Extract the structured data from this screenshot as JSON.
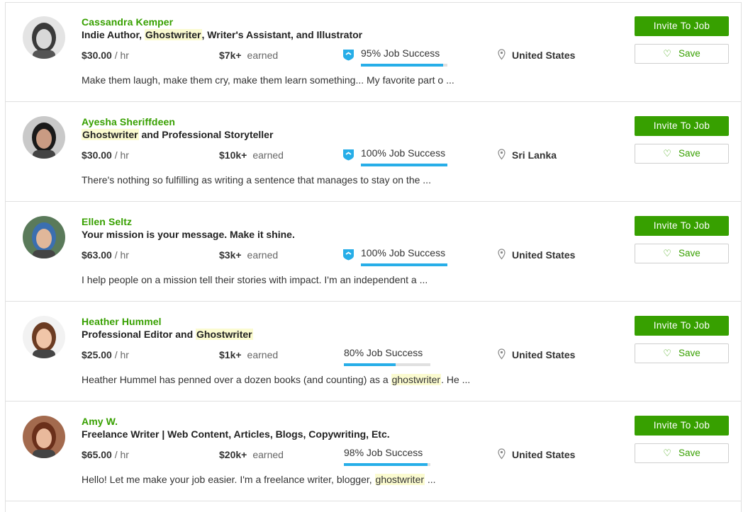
{
  "freelancers": [
    {
      "name": "Cassandra Kemper",
      "title_parts": [
        "Indie Author, ",
        "Ghostwriter",
        ", Writer's Assistant, and Illustrator"
      ],
      "rate": "$30.00",
      "rate_unit": "/ hr",
      "earned": "$7k+",
      "earned_label": "earned",
      "job_success": "95% Job Success",
      "job_success_pct": 95,
      "top_rated": true,
      "location": "United States",
      "desc_parts": [
        "Make them laugh, make them cry, make them learn something... My favorite part o ...",
        "",
        ""
      ],
      "invite_label": "Invite To Job",
      "save_label": "Save"
    },
    {
      "name": "Ayesha Sheriffdeen",
      "title_parts": [
        "",
        "Ghostwriter",
        " and Professional Storyteller"
      ],
      "rate": "$30.00",
      "rate_unit": "/ hr",
      "earned": "$10k+",
      "earned_label": "earned",
      "job_success": "100% Job Success",
      "job_success_pct": 100,
      "top_rated": true,
      "location": "Sri Lanka",
      "desc_parts": [
        "There's nothing so fulfilling as writing a sentence that manages to stay on the ...",
        "",
        ""
      ],
      "invite_label": "Invite To Job",
      "save_label": "Save"
    },
    {
      "name": "Ellen Seltz",
      "title_parts": [
        "Your mission is your message. Make it shine.",
        "",
        ""
      ],
      "rate": "$63.00",
      "rate_unit": "/ hr",
      "earned": "$3k+",
      "earned_label": "earned",
      "job_success": "100% Job Success",
      "job_success_pct": 100,
      "top_rated": true,
      "location": "United States",
      "desc_parts": [
        "I help people on a mission tell their stories with impact. I'm an independent a ...",
        "",
        ""
      ],
      "invite_label": "Invite To Job",
      "save_label": "Save"
    },
    {
      "name": "Heather Hummel",
      "title_parts": [
        "Professional Editor and ",
        "Ghostwriter",
        ""
      ],
      "rate": "$25.00",
      "rate_unit": "/ hr",
      "earned": "$1k+",
      "earned_label": "earned",
      "job_success": "80% Job Success",
      "job_success_pct": 60,
      "top_rated": false,
      "location": "United States",
      "desc_parts": [
        "Heather Hummel has penned over a dozen books (and counting) as a ",
        "ghostwriter",
        ". He ..."
      ],
      "invite_label": "Invite To Job",
      "save_label": "Save"
    },
    {
      "name": "Amy W.",
      "title_parts": [
        "Freelance Writer | Web Content, Articles, Blogs, Copywriting, Etc.",
        "",
        ""
      ],
      "rate": "$65.00",
      "rate_unit": "/ hr",
      "earned": "$20k+",
      "earned_label": "earned",
      "job_success": "98% Job Success",
      "job_success_pct": 97,
      "top_rated": false,
      "location": "United States",
      "desc_parts": [
        "Hello! Let me make your job easier. I'm a freelance writer, blogger, ",
        "ghostwriter",
        " ..."
      ],
      "invite_label": "Invite To Job",
      "save_label": "Save"
    }
  ],
  "colors": {
    "accent": "#37a000",
    "progress": "#27aee8",
    "badge": "#27aee8",
    "highlight": "#fbfbd0"
  },
  "icons": {
    "top_rated_badge": "shield-badge-icon",
    "location": "map-pin-icon",
    "save": "heart-outline-icon"
  }
}
